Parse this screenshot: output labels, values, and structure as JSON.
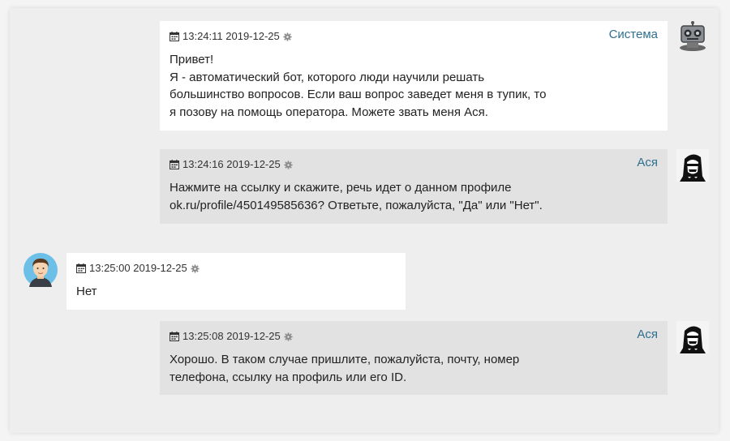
{
  "messages": [
    {
      "time": "13:24:11 2019-12-25",
      "author": "Система",
      "text": "Привет!\nЯ - автоматический бот, которого люди научили решать\nбольшинство вопросов. Если ваш вопрос заведет меня в тупик, то\nя позову на помощь оператора. Можете звать меня Ася.",
      "avatar": "robot-avatar"
    },
    {
      "time": "13:24:16 2019-12-25",
      "author": "Ася",
      "text": "Нажмите на ссылку и скажите, речь идет о данном профиле\nok.ru/profile/450149585636? Ответьте, пожалуйста, \"Да\" или \"Нет\".",
      "avatar": "operator-avatar"
    },
    {
      "time": "13:25:00 2019-12-25",
      "author": "",
      "text": "Нет",
      "avatar": "user-avatar"
    },
    {
      "time": "13:25:08 2019-12-25",
      "author": "Ася",
      "text": "Хорошо. В таком случае пришлите, пожалуйста, почту, номер\nтелефона, ссылку на профиль или его ID.",
      "avatar": "operator-avatar"
    }
  ],
  "colors": {
    "author_link": "#2f6f8f",
    "bubble_system": "#ffffff",
    "bubble_operator": "#e2e2e2",
    "bubble_user": "#ffffff"
  }
}
